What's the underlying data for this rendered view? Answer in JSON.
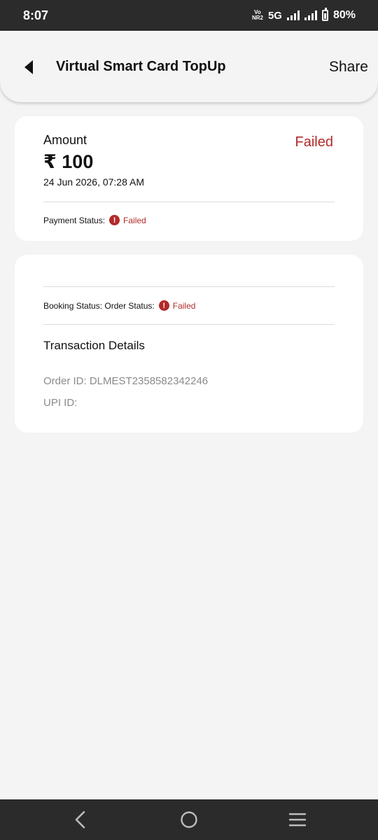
{
  "status_bar": {
    "time": "8:07",
    "carrier_top": "Vo",
    "carrier_bottom": "NR2",
    "network": "5G",
    "battery": "80%"
  },
  "header": {
    "title": "Virtual Smart Card TopUp",
    "share_label": "Share"
  },
  "amount_card": {
    "amount_label": "Amount",
    "amount_value": "₹ 100",
    "date": "24 Jun 2026, 07:28 AM",
    "status": "Failed",
    "payment_status_label": "Payment Status:",
    "payment_status_value": "Failed",
    "status_icon_glyph": "!"
  },
  "details_card": {
    "booking_status_label": "Booking Status: Order Status:",
    "booking_status_value": "Failed",
    "status_icon_glyph": "!",
    "section_title": "Transaction Details",
    "order_id": "Order ID: DLMEST2358582342246",
    "upi_id": "UPI ID:"
  },
  "colors": {
    "failed": "#b22a2a",
    "card_bg": "#ffffff",
    "page_bg": "#f4f4f4",
    "system_bar": "#2b2b2b"
  },
  "icons": {
    "back": "back-triangle-icon",
    "nav_back": "chevron-left-icon",
    "nav_home": "circle-home-icon",
    "nav_menu": "hamburger-icon"
  }
}
